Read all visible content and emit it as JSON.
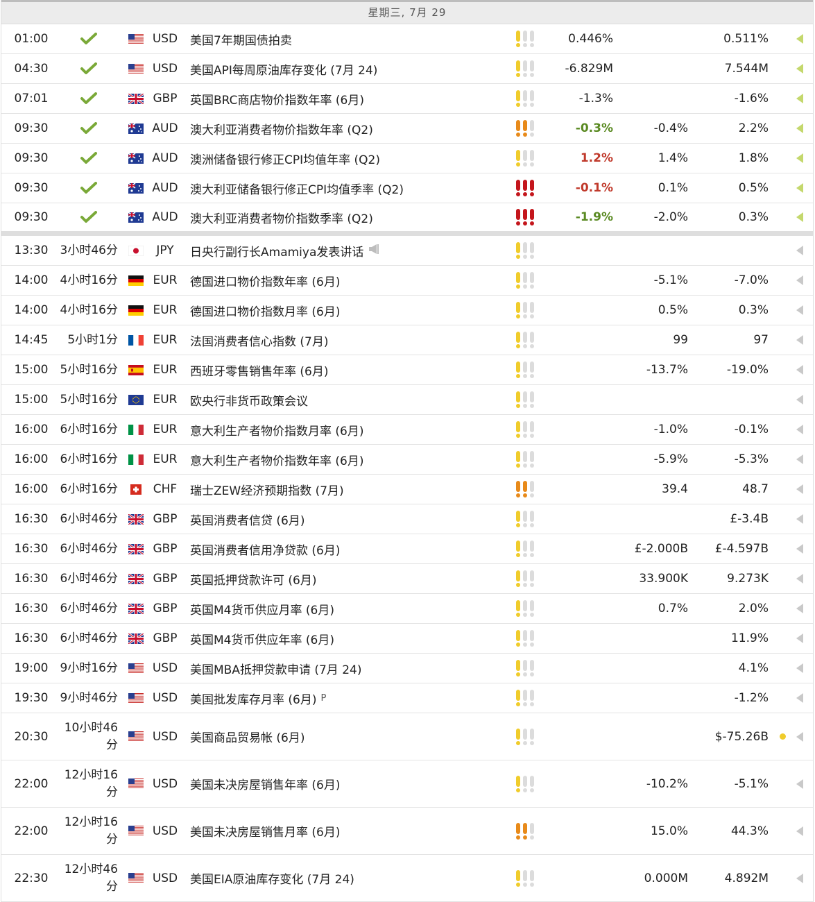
{
  "header": {
    "date": "星期三, 7月 29"
  },
  "rows": [
    {
      "time": "01:00",
      "remaining": "",
      "done": true,
      "flag": "us",
      "currency": "USD",
      "event": "美国7年期国债拍卖",
      "importance": 1,
      "actual": "0.446%",
      "actual_color": "neutral",
      "forecast": "",
      "previous": "0.511%",
      "dot": false,
      "arrow": "green"
    },
    {
      "time": "04:30",
      "remaining": "",
      "done": true,
      "flag": "us",
      "currency": "USD",
      "event": "美国API每周原油库存变化 (7月 24)",
      "importance": 1,
      "actual": "-6.829M",
      "actual_color": "neutral",
      "forecast": "",
      "previous": "7.544M",
      "dot": false,
      "arrow": "green"
    },
    {
      "time": "07:01",
      "remaining": "",
      "done": true,
      "flag": "gb",
      "currency": "GBP",
      "event": "英国BRC商店物价指数年率 (6月)",
      "importance": 1,
      "actual": "-1.3%",
      "actual_color": "neutral",
      "forecast": "",
      "previous": "-1.6%",
      "dot": false,
      "arrow": "green"
    },
    {
      "time": "09:30",
      "remaining": "",
      "done": true,
      "flag": "au",
      "currency": "AUD",
      "event": "澳大利亚消费者物价指数年率 (Q2)",
      "importance": 2,
      "actual": "-0.3%",
      "actual_color": "pos",
      "forecast": "-0.4%",
      "previous": "2.2%",
      "dot": false,
      "arrow": "green"
    },
    {
      "time": "09:30",
      "remaining": "",
      "done": true,
      "flag": "au",
      "currency": "AUD",
      "event": "澳洲储备银行修正CPI均值年率 (Q2)",
      "importance": 1,
      "actual": "1.2%",
      "actual_color": "neg",
      "forecast": "1.4%",
      "previous": "1.8%",
      "dot": false,
      "arrow": "green"
    },
    {
      "time": "09:30",
      "remaining": "",
      "done": true,
      "flag": "au",
      "currency": "AUD",
      "event": "澳大利亚储备银行修正CPI均值季率 (Q2)",
      "importance": 3,
      "actual": "-0.1%",
      "actual_color": "neg",
      "forecast": "0.1%",
      "previous": "0.5%",
      "dot": false,
      "arrow": "green"
    },
    {
      "time": "09:30",
      "remaining": "",
      "done": true,
      "flag": "au",
      "currency": "AUD",
      "event": "澳大利亚消费者物价指数季率 (Q2)",
      "importance": 3,
      "actual": "-1.9%",
      "actual_color": "pos",
      "forecast": "-2.0%",
      "previous": "0.3%",
      "dot": false,
      "arrow": "green",
      "sep": true
    },
    {
      "time": "13:30",
      "remaining": "3小时46分",
      "done": false,
      "flag": "jp",
      "currency": "JPY",
      "event": "日央行副行长Amamiya发表讲话",
      "speaker": true,
      "importance": 1,
      "actual": "",
      "forecast": "",
      "previous": "",
      "dot": false,
      "arrow": "grey"
    },
    {
      "time": "14:00",
      "remaining": "4小时16分",
      "done": false,
      "flag": "de",
      "currency": "EUR",
      "event": "德国进口物价指数年率 (6月)",
      "importance": 1,
      "actual": "",
      "forecast": "-5.1%",
      "previous": "-7.0%",
      "dot": false,
      "arrow": "grey"
    },
    {
      "time": "14:00",
      "remaining": "4小时16分",
      "done": false,
      "flag": "de",
      "currency": "EUR",
      "event": "德国进口物价指数月率 (6月)",
      "importance": 1,
      "actual": "",
      "forecast": "0.5%",
      "previous": "0.3%",
      "dot": false,
      "arrow": "grey"
    },
    {
      "time": "14:45",
      "remaining": "5小时1分",
      "done": false,
      "flag": "fr",
      "currency": "EUR",
      "event": "法国消费者信心指数 (7月)",
      "importance": 1,
      "actual": "",
      "forecast": "99",
      "previous": "97",
      "dot": false,
      "arrow": "grey"
    },
    {
      "time": "15:00",
      "remaining": "5小时16分",
      "done": false,
      "flag": "es",
      "currency": "EUR",
      "event": "西班牙零售销售年率 (6月)",
      "importance": 1,
      "actual": "",
      "forecast": "-13.7%",
      "previous": "-19.0%",
      "dot": false,
      "arrow": "grey"
    },
    {
      "time": "15:00",
      "remaining": "5小时16分",
      "done": false,
      "flag": "eu",
      "currency": "EUR",
      "event": "欧央行非货币政策会议",
      "importance": 1,
      "actual": "",
      "forecast": "",
      "previous": "",
      "dot": false,
      "arrow": "grey"
    },
    {
      "time": "16:00",
      "remaining": "6小时16分",
      "done": false,
      "flag": "it",
      "currency": "EUR",
      "event": "意大利生产者物价指数月率 (6月)",
      "importance": 1,
      "actual": "",
      "forecast": "-1.0%",
      "previous": "-0.1%",
      "dot": false,
      "arrow": "grey"
    },
    {
      "time": "16:00",
      "remaining": "6小时16分",
      "done": false,
      "flag": "it",
      "currency": "EUR",
      "event": "意大利生产者物价指数年率 (6月)",
      "importance": 1,
      "actual": "",
      "forecast": "-5.9%",
      "previous": "-5.3%",
      "dot": false,
      "arrow": "grey"
    },
    {
      "time": "16:00",
      "remaining": "6小时16分",
      "done": false,
      "flag": "ch",
      "currency": "CHF",
      "event": "瑞士ZEW经济预期指数 (7月)",
      "importance": 2,
      "actual": "",
      "forecast": "39.4",
      "previous": "48.7",
      "dot": false,
      "arrow": "grey"
    },
    {
      "time": "16:30",
      "remaining": "6小时46分",
      "done": false,
      "flag": "gb",
      "currency": "GBP",
      "event": "英国消费者信贷 (6月)",
      "importance": 1,
      "actual": "",
      "forecast": "",
      "previous": "£-3.4B",
      "dot": false,
      "arrow": "grey"
    },
    {
      "time": "16:30",
      "remaining": "6小时46分",
      "done": false,
      "flag": "gb",
      "currency": "GBP",
      "event": "英国消费者信用净贷款 (6月)",
      "importance": 1,
      "actual": "",
      "forecast": "£-2.000B",
      "previous": "£-4.597B",
      "dot": false,
      "arrow": "grey"
    },
    {
      "time": "16:30",
      "remaining": "6小时46分",
      "done": false,
      "flag": "gb",
      "currency": "GBP",
      "event": "英国抵押贷款许可 (6月)",
      "importance": 1,
      "actual": "",
      "forecast": "33.900K",
      "previous": "9.273K",
      "dot": false,
      "arrow": "grey"
    },
    {
      "time": "16:30",
      "remaining": "6小时46分",
      "done": false,
      "flag": "gb",
      "currency": "GBP",
      "event": "英国M4货币供应月率 (6月)",
      "importance": 1,
      "actual": "",
      "forecast": "0.7%",
      "previous": "2.0%",
      "dot": false,
      "arrow": "grey"
    },
    {
      "time": "16:30",
      "remaining": "6小时46分",
      "done": false,
      "flag": "gb",
      "currency": "GBP",
      "event": "英国M4货币供应年率 (6月)",
      "importance": 1,
      "actual": "",
      "forecast": "",
      "previous": "11.9%",
      "dot": false,
      "arrow": "grey"
    },
    {
      "time": "19:00",
      "remaining": "9小时16分",
      "done": false,
      "flag": "us",
      "currency": "USD",
      "event": "美国MBA抵押贷款申请 (7月 24)",
      "importance": 1,
      "actual": "",
      "forecast": "",
      "previous": "4.1%",
      "dot": false,
      "arrow": "grey"
    },
    {
      "time": "19:30",
      "remaining": "9小时46分",
      "done": false,
      "flag": "us",
      "currency": "USD",
      "event": "美国批发库存月率 (6月)",
      "suffix": "P",
      "importance": 1,
      "actual": "",
      "forecast": "",
      "previous": "-1.2%",
      "dot": false,
      "arrow": "grey"
    },
    {
      "time": "20:30",
      "remaining": "10小时46分",
      "done": false,
      "flag": "us",
      "currency": "USD",
      "event": "美国商品贸易帐 (6月)",
      "importance": 1,
      "actual": "",
      "forecast": "",
      "previous": "$-75.26B",
      "dot": true,
      "arrow": "grey",
      "tall": true
    },
    {
      "time": "22:00",
      "remaining": "12小时16分",
      "done": false,
      "flag": "us",
      "currency": "USD",
      "event": "美国未决房屋销售年率 (6月)",
      "importance": 1,
      "actual": "",
      "forecast": "-10.2%",
      "previous": "-5.1%",
      "dot": false,
      "arrow": "grey",
      "tall": true
    },
    {
      "time": "22:00",
      "remaining": "12小时16分",
      "done": false,
      "flag": "us",
      "currency": "USD",
      "event": "美国未决房屋销售月率 (6月)",
      "importance": 2,
      "actual": "",
      "forecast": "15.0%",
      "previous": "44.3%",
      "dot": false,
      "arrow": "grey",
      "tall": true
    },
    {
      "time": "22:30",
      "remaining": "12小时46分",
      "done": false,
      "flag": "us",
      "currency": "USD",
      "event": "美国EIA原油库存变化 (7月 24)",
      "importance": 1,
      "actual": "",
      "forecast": "0.000M",
      "previous": "4.892M",
      "dot": false,
      "arrow": "grey",
      "tall": true
    }
  ],
  "colors": {
    "positive": "#5a8a22",
    "negative": "#c0392b",
    "importance_low": "#f0cc2b",
    "importance_mid": "#e88a1a",
    "importance_high": "#c4161c"
  }
}
